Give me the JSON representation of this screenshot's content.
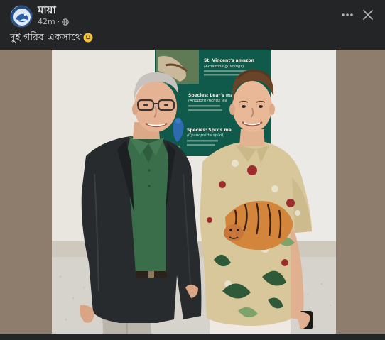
{
  "post": {
    "author": "মায়া",
    "time": "42m",
    "audience_icon": "globe-icon",
    "caption": "দুই গরিব একসাথে",
    "caption_emoji": "smiling-face-emoji"
  },
  "actions": {
    "more_icon": "more-options-icon",
    "close_icon": "close-icon"
  },
  "image": {
    "sign_title": "St. Vincent's amazon",
    "sign_subtitle": "(Amazona guildingii)",
    "sign_species_2": "Species: Lear's ma",
    "sign_species_2_sub": "(Anodorhynchus lea",
    "sign_species_3": "Species: Spix's ma",
    "sign_species_3_sub": "(Cyanopsitta spixii)"
  },
  "colors": {
    "background": "#242526",
    "text_primary": "#e4e6eb",
    "text_secondary": "#b0b3b8",
    "media_bg": "#8e7c6c"
  }
}
